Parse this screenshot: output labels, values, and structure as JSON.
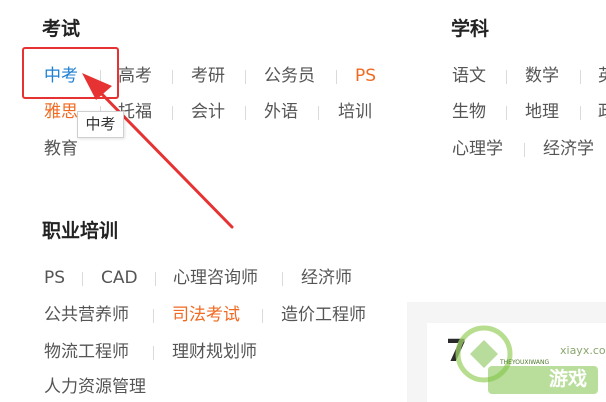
{
  "sections": {
    "exam": {
      "title": "考试",
      "links": [
        "中考",
        "高考",
        "考研",
        "公务员",
        "PS",
        "雅思",
        "托福",
        "会计",
        "外语",
        "培训",
        "教育"
      ]
    },
    "subject": {
      "title": "学科",
      "links": [
        "语文",
        "数学",
        "英",
        "生物",
        "地理",
        "政",
        "心理学",
        "经济学"
      ]
    },
    "vocational": {
      "title": "职业培训",
      "links": [
        "PS",
        "CAD",
        "心理咨询师",
        "经济师",
        "公共营养师",
        "司法考试",
        "造价工程师",
        "物流工程师",
        "理财规划师",
        "人力资源管理"
      ]
    }
  },
  "tooltip": "中考",
  "ad": {
    "number": "7"
  },
  "watermark": {
    "brand": "游戏",
    "sub_latin": "THEYOUXIWANG",
    "site": "xiayx.com"
  },
  "colors": {
    "link": "#555555",
    "hot": "#f06a22",
    "active": "#1f7fd0",
    "annotation": "#e63232"
  }
}
